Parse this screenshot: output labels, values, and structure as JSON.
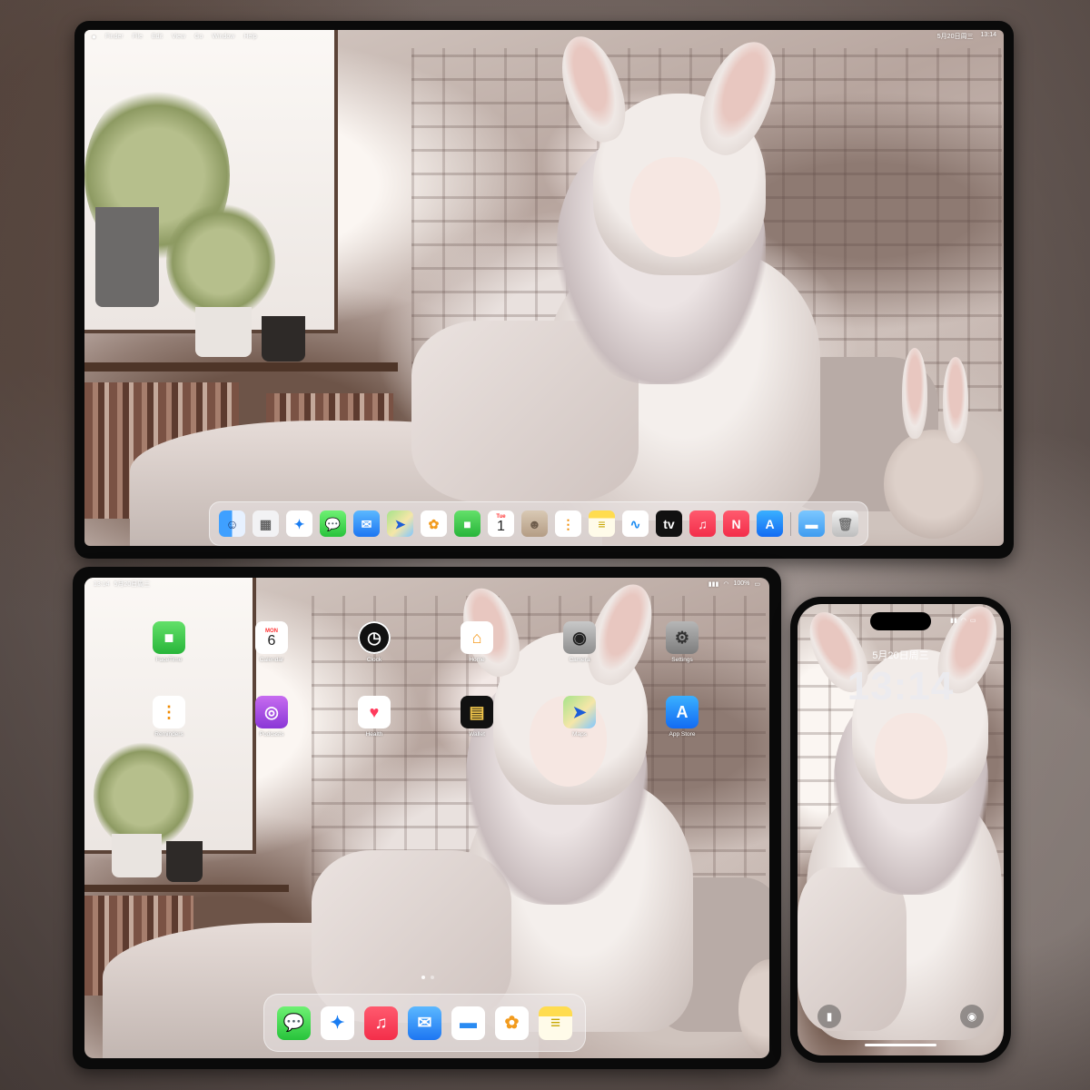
{
  "mac": {
    "menu": [
      "Finder",
      "File",
      "Edit",
      "View",
      "Go",
      "Window",
      "Help"
    ],
    "datetime": "5月20日周三",
    "time": "13:14",
    "dock_apps": [
      {
        "name": "Finder",
        "glyph": "☺",
        "cls": "c-finder"
      },
      {
        "name": "Launchpad",
        "glyph": "▦",
        "cls": "c-launch"
      },
      {
        "name": "Safari",
        "glyph": "✦",
        "cls": "c-safari"
      },
      {
        "name": "Messages",
        "glyph": "💬",
        "cls": "c-messages"
      },
      {
        "name": "Mail",
        "glyph": "✉",
        "cls": "c-mail"
      },
      {
        "name": "Maps",
        "glyph": "➤",
        "cls": "c-maps"
      },
      {
        "name": "Photos",
        "glyph": "✿",
        "cls": "c-photos"
      },
      {
        "name": "FaceTime",
        "glyph": "■",
        "cls": "c-facetime"
      },
      {
        "name": "Calendar",
        "glyph": "1",
        "cls": "c-calendar",
        "day": "Tue"
      },
      {
        "name": "Contacts",
        "glyph": "☻",
        "cls": "c-contacts"
      },
      {
        "name": "Reminders",
        "glyph": "⋮",
        "cls": "c-reminders"
      },
      {
        "name": "Notes",
        "glyph": "≡",
        "cls": "c-notes"
      },
      {
        "name": "Freeform",
        "glyph": "∿",
        "cls": "c-freeform"
      },
      {
        "name": "TV",
        "glyph": "tv",
        "cls": "c-tv"
      },
      {
        "name": "Music",
        "glyph": "♫",
        "cls": "c-music"
      },
      {
        "name": "News",
        "glyph": "N",
        "cls": "c-news"
      },
      {
        "name": "App Store",
        "glyph": "A",
        "cls": "c-appstore"
      }
    ],
    "dock_extras": [
      {
        "name": "Downloads",
        "glyph": "▬",
        "cls": "c-folder"
      },
      {
        "name": "Trash",
        "glyph": "🗑",
        "cls": "c-trash"
      }
    ]
  },
  "ipad": {
    "time": "13:14",
    "date": "5月20日周三",
    "battery": "100%",
    "apps": [
      {
        "name": "FaceTime",
        "label": "FaceTime",
        "glyph": "■",
        "cls": "c-facetime"
      },
      {
        "name": "Calendar",
        "label": "Calendar",
        "glyph": "6",
        "cls": "c-calendar",
        "day": "MON"
      },
      {
        "name": "Clock",
        "label": "Clock",
        "glyph": "◷",
        "cls": "c-clock"
      },
      {
        "name": "Home",
        "label": "Home",
        "glyph": "⌂",
        "cls": "c-home"
      },
      {
        "name": "Camera",
        "label": "Camera",
        "glyph": "◉",
        "cls": "c-camera"
      },
      {
        "name": "Settings",
        "label": "Settings",
        "glyph": "⚙",
        "cls": "c-settings"
      },
      {
        "name": "Reminders",
        "label": "Reminders",
        "glyph": "⋮",
        "cls": "c-reminders"
      },
      {
        "name": "Podcasts",
        "label": "Podcasts",
        "glyph": "◎",
        "cls": "c-podcasts"
      },
      {
        "name": "Health",
        "label": "Health",
        "glyph": "♥",
        "cls": "c-health"
      },
      {
        "name": "Wallet",
        "label": "Wallet",
        "glyph": "▤",
        "cls": "c-wallet"
      },
      {
        "name": "Maps",
        "label": "Maps",
        "glyph": "➤",
        "cls": "c-maps"
      },
      {
        "name": "App Store",
        "label": "App Store",
        "glyph": "A",
        "cls": "c-appstore"
      }
    ],
    "dock_apps": [
      {
        "name": "Messages",
        "glyph": "💬",
        "cls": "c-messages"
      },
      {
        "name": "Safari",
        "glyph": "✦",
        "cls": "c-safari"
      },
      {
        "name": "Music",
        "glyph": "♫",
        "cls": "c-music"
      },
      {
        "name": "Mail",
        "glyph": "✉",
        "cls": "c-mail"
      },
      {
        "name": "Files",
        "glyph": "▬",
        "cls": "c-files"
      },
      {
        "name": "Photos",
        "glyph": "✿",
        "cls": "c-photos"
      },
      {
        "name": "Notes",
        "glyph": "≡",
        "cls": "c-notes"
      }
    ]
  },
  "iphone": {
    "date": "5月20日周三",
    "time": "13:14",
    "flashlight_icon": "flashlight-icon",
    "camera_icon": "camera-icon"
  }
}
